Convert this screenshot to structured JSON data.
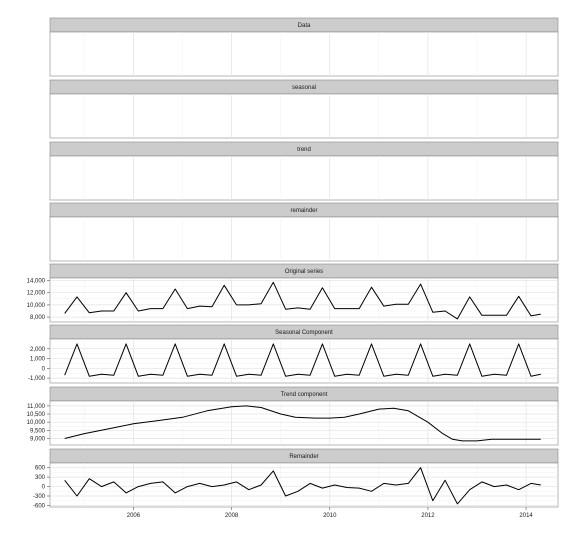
{
  "chart_data": {
    "type": "line",
    "x_axis": {
      "ticks": [
        2006,
        2008,
        2010,
        2012,
        2014
      ],
      "range": [
        2004.3,
        2014.65
      ]
    },
    "grid": true,
    "panels": [
      {
        "title": "Data",
        "empty": true
      },
      {
        "title": "seasonal",
        "empty": true
      },
      {
        "title": "trend",
        "empty": true
      },
      {
        "title": "remainder",
        "empty": true
      },
      {
        "title": "Original series",
        "yticks": [
          8000,
          10000,
          12000,
          14000
        ],
        "ytick_labels": [
          "8,000",
          "10,000",
          "12,000",
          "14,000"
        ],
        "ylim": [
          7200,
          14400
        ],
        "series": [
          {
            "x": [
              2004.6,
              2004.85,
              2005.1,
              2005.35,
              2005.6,
              2005.85,
              2006.1,
              2006.35,
              2006.6,
              2006.85,
              2007.1,
              2007.35,
              2007.6,
              2007.85,
              2008.1,
              2008.35,
              2008.6,
              2008.85,
              2009.1,
              2009.35,
              2009.6,
              2009.85,
              2010.1,
              2010.35,
              2010.6,
              2010.85,
              2011.1,
              2011.35,
              2011.6,
              2011.85,
              2012.1,
              2012.35,
              2012.6,
              2012.85,
              2013.1,
              2013.35,
              2013.6,
              2013.85,
              2014.1,
              2014.3
            ],
            "y": [
              8600,
              11300,
              8700,
              9000,
              9000,
              12000,
              9000,
              9400,
              9400,
              12600,
              9400,
              9800,
              9700,
              13200,
              10000,
              10000,
              10200,
              13700,
              9300,
              9500,
              9300,
              12800,
              9400,
              9400,
              9400,
              12900,
              9800,
              10100,
              10100,
              13400,
              8800,
              9000,
              7700,
              11300,
              8300,
              8300,
              8300,
              11400,
              8200,
              8500
            ]
          }
        ]
      },
      {
        "title": "Seasonal Component",
        "yticks": [
          -1000,
          0,
          1000,
          2000
        ],
        "ytick_labels": [
          "-1,000",
          "0",
          "1,000",
          "2,000"
        ],
        "ylim": [
          -1500,
          3000
        ],
        "series": [
          {
            "x": [
              2004.6,
              2004.85,
              2005.1,
              2005.35,
              2005.6,
              2005.85,
              2006.1,
              2006.35,
              2006.6,
              2006.85,
              2007.1,
              2007.35,
              2007.6,
              2007.85,
              2008.1,
              2008.35,
              2008.6,
              2008.85,
              2009.1,
              2009.35,
              2009.6,
              2009.85,
              2010.1,
              2010.35,
              2010.6,
              2010.85,
              2011.1,
              2011.35,
              2011.6,
              2011.85,
              2012.1,
              2012.35,
              2012.6,
              2012.85,
              2013.1,
              2013.35,
              2013.6,
              2013.85,
              2014.1,
              2014.3
            ],
            "y": [
              -700,
              2500,
              -800,
              -600,
              -700,
              2500,
              -800,
              -600,
              -700,
              2500,
              -800,
              -600,
              -700,
              2500,
              -800,
              -600,
              -700,
              2500,
              -800,
              -600,
              -700,
              2500,
              -800,
              -600,
              -700,
              2500,
              -800,
              -600,
              -700,
              2500,
              -800,
              -600,
              -700,
              2500,
              -800,
              -600,
              -700,
              2500,
              -800,
              -600
            ]
          }
        ]
      },
      {
        "title": "Trend component",
        "yticks": [
          9000,
          9500,
          10000,
          10500,
          11000
        ],
        "ytick_labels": [
          "9,000",
          "9,500",
          "10,000",
          "10,500",
          "11,000"
        ],
        "ylim": [
          8600,
          11300
        ],
        "series": [
          {
            "x": [
              2004.6,
              2005.0,
              2005.5,
              2006.0,
              2006.5,
              2007.0,
              2007.5,
              2008.0,
              2008.3,
              2008.6,
              2009.0,
              2009.3,
              2009.7,
              2010.0,
              2010.3,
              2010.6,
              2011.0,
              2011.3,
              2011.6,
              2012.0,
              2012.3,
              2012.5,
              2012.7,
              2013.0,
              2013.3,
              2013.7,
              2014.0,
              2014.3
            ],
            "y": [
              9000,
              9300,
              9600,
              9900,
              10100,
              10300,
              10700,
              10950,
              11000,
              10900,
              10500,
              10300,
              10250,
              10250,
              10300,
              10500,
              10800,
              10850,
              10700,
              10000,
              9300,
              8950,
              8850,
              8850,
              8950,
              8950,
              8950,
              8950
            ]
          }
        ]
      },
      {
        "title": "Remainder",
        "yticks": [
          -600,
          -300,
          0,
          300,
          600
        ],
        "ytick_labels": [
          "-600",
          "-300",
          "0",
          "300",
          "600"
        ],
        "ylim": [
          -650,
          750
        ],
        "series": [
          {
            "x": [
              2004.6,
              2004.85,
              2005.1,
              2005.35,
              2005.6,
              2005.85,
              2006.1,
              2006.35,
              2006.6,
              2006.85,
              2007.1,
              2007.35,
              2007.6,
              2007.85,
              2008.1,
              2008.35,
              2008.6,
              2008.85,
              2009.1,
              2009.35,
              2009.6,
              2009.85,
              2010.1,
              2010.35,
              2010.6,
              2010.85,
              2011.1,
              2011.35,
              2011.6,
              2011.85,
              2012.1,
              2012.35,
              2012.6,
              2012.85,
              2013.1,
              2013.35,
              2013.6,
              2013.85,
              2014.1,
              2014.3
            ],
            "y": [
              200,
              -300,
              250,
              0,
              150,
              -200,
              0,
              100,
              150,
              -200,
              0,
              100,
              0,
              50,
              150,
              -100,
              50,
              500,
              -300,
              -150,
              100,
              -50,
              50,
              -30,
              -50,
              -150,
              100,
              50,
              100,
              600,
              -450,
              200,
              -550,
              -100,
              150,
              0,
              50,
              -100,
              100,
              50
            ]
          }
        ]
      }
    ]
  }
}
